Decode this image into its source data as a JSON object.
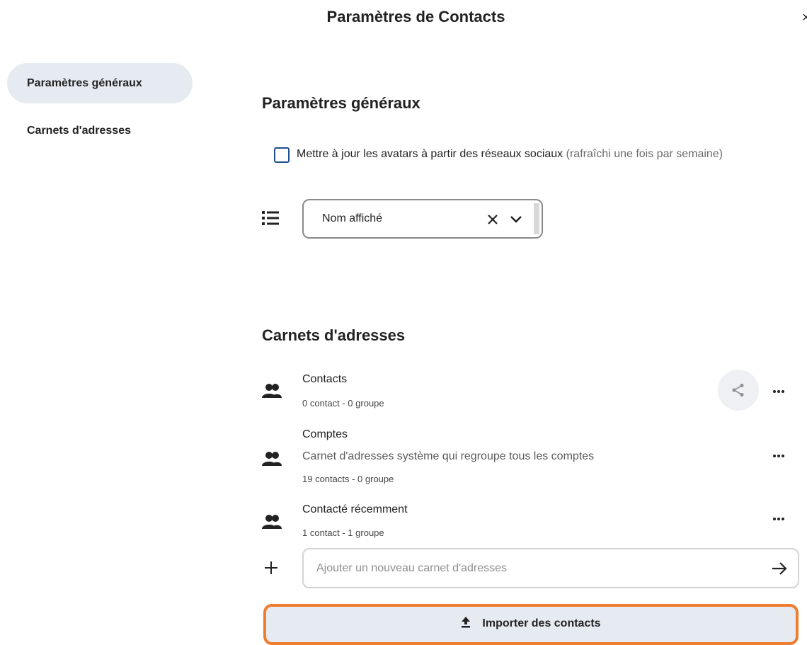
{
  "dialog": {
    "title": "Paramètres de Contacts",
    "close_label": "×"
  },
  "sidebar": {
    "items": [
      {
        "label": "Paramètres généraux",
        "active": true
      },
      {
        "label": "Carnets d'adresses",
        "active": false
      }
    ]
  },
  "general": {
    "heading": "Paramètres généraux",
    "avatar_checkbox": {
      "checked": false,
      "label": "Mettre à jour les avatars à partir des réseaux sociaux",
      "note": "(rafraîchi une fois par semaine)"
    },
    "sort_select": {
      "icon": "list-sort-icon",
      "value": "Nom affiché"
    }
  },
  "address_books": {
    "heading": "Carnets d'adresses",
    "items": [
      {
        "name": "Contacts",
        "description": "",
        "meta": "0 contact  - 0 groupe",
        "shareable": true
      },
      {
        "name": "Comptes",
        "description": "Carnet d'adresses système qui regroupe tous les comptes",
        "meta": "19 contacts  - 0 groupe",
        "shareable": false
      },
      {
        "name": "Contacté récemment",
        "description": "",
        "meta": "1 contact  - 1 groupe",
        "shareable": false
      }
    ],
    "new_placeholder": "Ajouter un nouveau carnet d'adresses",
    "import_label": "Importer des contacts"
  },
  "colors": {
    "accent": "#1d4f91",
    "nav_active": "#e6ebf2",
    "highlight": "#ee7d30"
  }
}
